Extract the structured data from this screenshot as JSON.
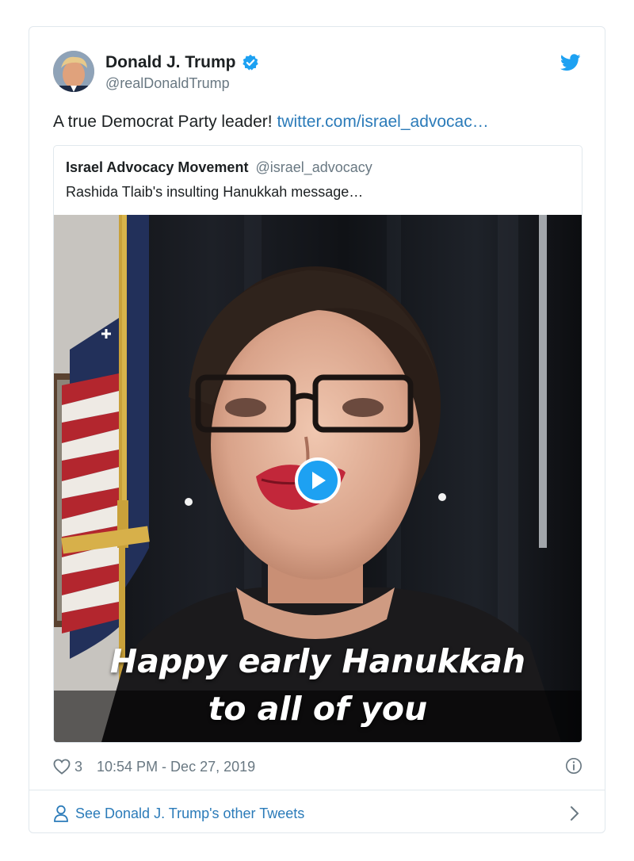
{
  "author": {
    "name": "Donald J. Trump",
    "handle": "@realDonaldTrump",
    "avatar_icon": "user-avatar-photo",
    "verified_icon": "verified-badge-icon"
  },
  "brand": {
    "icon": "twitter-bird-icon",
    "color": "#1da1f2"
  },
  "tweet": {
    "text": "A true Democrat Party leader!",
    "link": "twitter.com/israel_advocac…"
  },
  "quoted": {
    "name": "Israel Advocacy Movement",
    "handle": "@israel_advocacy",
    "text": "Rashida Tlaib's insulting Hanukkah message…",
    "video_caption_line1": "Happy early Hanukkah",
    "video_caption_line2": "to all of you",
    "play_icon": "play-icon"
  },
  "footer": {
    "likes": "3",
    "timestamp": "10:54 PM - Dec 27, 2019",
    "heart_icon": "heart-icon",
    "info_icon": "info-icon"
  },
  "see_more": {
    "label": "See Donald J. Trump's other Tweets",
    "person_icon": "person-icon",
    "chevron_icon": "chevron-right-icon"
  },
  "colors": {
    "text": "#1c2022",
    "muted": "#697882",
    "link": "#2b7bb9",
    "border": "#e1e8ed"
  }
}
